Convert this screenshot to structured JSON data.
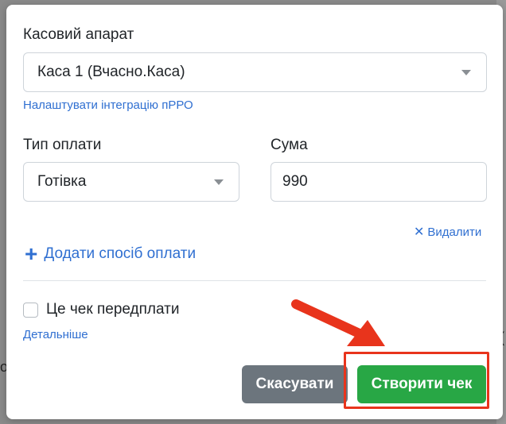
{
  "modal": {
    "register_label": "Касовий апарат",
    "register_value": "Каса 1 (Вчасно.Каса)",
    "configure_link": "Налаштувати інтеграцію пРРО",
    "payment_type_label": "Тип оплати",
    "payment_type_value": "Готівка",
    "amount_label": "Сума",
    "amount_value": "990",
    "remove_link": "Видалити",
    "add_payment_link": "Додати спосіб оплати",
    "prepayment_label": "Це чек передплати",
    "details_link": "Детальніше",
    "cancel_button": "Скасувати",
    "create_button": "Створити чек"
  },
  "backdrop": {
    "left_text": "о",
    "right_text": "("
  },
  "colors": {
    "primary_link": "#2f6fd1",
    "create_button": "#28a745",
    "cancel_button": "#6c757d",
    "annotation": "#e8341c"
  },
  "icons": {
    "select_caret": "caret-down-icon",
    "add": "plus-icon",
    "remove": "close-icon",
    "annotation_arrow": "arrow-icon"
  }
}
